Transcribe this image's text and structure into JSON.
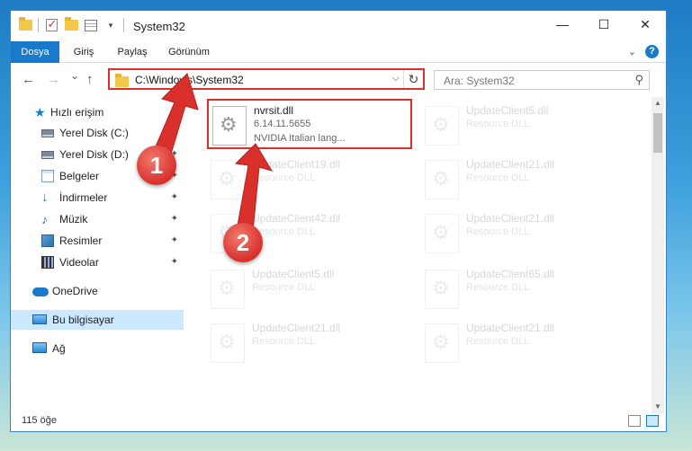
{
  "window": {
    "title": "System32",
    "controls": {
      "minimize": "—",
      "maximize": "☐",
      "close": "✕"
    }
  },
  "ribbon": {
    "tabs": [
      {
        "label": "Dosya",
        "active": true
      },
      {
        "label": "Giriş",
        "active": false
      },
      {
        "label": "Paylaş",
        "active": false
      },
      {
        "label": "Görünüm",
        "active": false
      }
    ],
    "expand_icon": "chevron-down-icon",
    "help_label": "?"
  },
  "nav": {
    "back": "←",
    "forward": "→",
    "recent": "⌄",
    "up": "↑",
    "address_path": "C:\\Windows\\System32",
    "address_dropdown": "⌵",
    "refresh": "↻",
    "search_placeholder": "Ara: System32",
    "search_icon": "⚲"
  },
  "sidebar": {
    "items": [
      {
        "label": "Hızlı erişim",
        "icon": "star-icon",
        "pinned": false
      },
      {
        "label": "Yerel Disk (C:)",
        "icon": "drive-icon",
        "pinned": true
      },
      {
        "label": "Yerel Disk (D:)",
        "icon": "drive-icon",
        "pinned": true
      },
      {
        "label": "Belgeler",
        "icon": "documents-icon",
        "pinned": true
      },
      {
        "label": "İndirmeler",
        "icon": "downloads-icon",
        "pinned": true
      },
      {
        "label": "Müzik",
        "icon": "music-icon",
        "pinned": true
      },
      {
        "label": "Resimler",
        "icon": "pictures-icon",
        "pinned": true
      },
      {
        "label": "Videolar",
        "icon": "videos-icon",
        "pinned": true
      },
      {
        "label": "OneDrive",
        "icon": "onedrive-icon",
        "pinned": false
      },
      {
        "label": "Bu bilgisayar",
        "icon": "this-pc-icon",
        "pinned": false,
        "selected": true
      },
      {
        "label": "Ağ",
        "icon": "network-icon",
        "pinned": false
      }
    ],
    "pin_glyph": "📌"
  },
  "files": [
    {
      "name": "nvrsit.dll",
      "version": "6.14.11.5655",
      "description": "NVIDIA Italian lang...",
      "highlighted": true
    },
    {
      "name": "UpdateClient5.dll",
      "version": "",
      "description": "Resource DLL",
      "highlighted": false
    },
    {
      "name": "UpdateClient19.dll",
      "version": "",
      "description": "Resource DLL",
      "highlighted": false
    },
    {
      "name": "UpdateClient21.dll",
      "version": "",
      "description": "Resource DLL",
      "highlighted": false
    },
    {
      "name": "UpdateClient42.dll",
      "version": "",
      "description": "Resource DLL",
      "highlighted": false
    },
    {
      "name": "UpdateClient21.dll",
      "version": "",
      "description": "Resource DLL",
      "highlighted": false
    },
    {
      "name": "UpdateClient5.dll",
      "version": "",
      "description": "Resource DLL",
      "highlighted": false
    },
    {
      "name": "UpdateClient65.dll",
      "version": "",
      "description": "Resource DLL",
      "highlighted": false
    },
    {
      "name": "UpdateClient21.dll",
      "version": "",
      "description": "Resource DLL",
      "highlighted": false
    },
    {
      "name": "UpdateClient21.dll",
      "version": "",
      "description": "Resource DLL",
      "highlighted": false
    }
  ],
  "status": {
    "item_count": "115 öğe"
  },
  "callouts": [
    {
      "label": "1"
    },
    {
      "label": "2"
    }
  ],
  "colors": {
    "accent": "#1979ca",
    "highlight": "#d9302c",
    "selected_bg": "#cce8ff"
  }
}
